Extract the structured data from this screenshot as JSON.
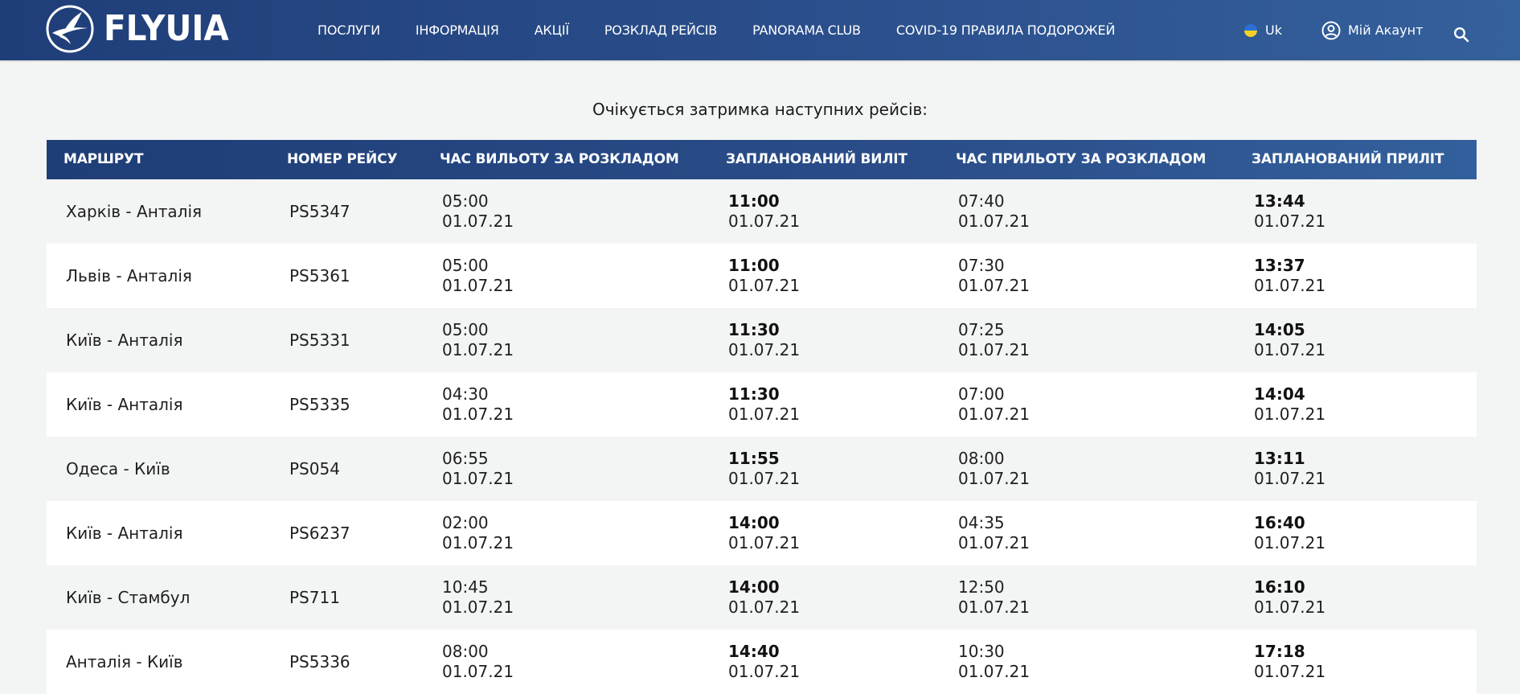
{
  "brand": {
    "name": "FLYUIA"
  },
  "nav": [
    {
      "label": "ПОСЛУГИ"
    },
    {
      "label": "ІНФОРМАЦІЯ"
    },
    {
      "label": "АКЦІЇ"
    },
    {
      "label": "РОЗКЛАД РЕЙСІВ"
    },
    {
      "label": "PANORAMA CLUB"
    },
    {
      "label": "COVID-19 ПРАВИЛА ПОДОРОЖЕЙ"
    }
  ],
  "language": {
    "label": "Uk",
    "flag_colors": [
      "#2d6fd6",
      "#f3d128"
    ]
  },
  "account": {
    "label": "Мій Акаунт"
  },
  "icons": {
    "search": "search-icon",
    "account": "user-circle-icon",
    "logo": "uia-logo-icon"
  },
  "headline": "Очікується затримка наступних рейсів:",
  "table": {
    "headers": {
      "route": "МАРШРУТ",
      "flight": "НОМЕР РЕЙСУ",
      "sched_dep": "ЧАС ВИЛЬОТУ ЗА РОЗКЛАДОМ",
      "planned_dep": "ЗАПЛАНОВАНИЙ ВИЛІТ",
      "sched_arr": "ЧАС ПРИЛЬОТУ ЗА РОЗКЛАДОМ",
      "planned_arr": "ЗАПЛАНОВАНИЙ ПРИЛІТ"
    },
    "rows": [
      {
        "route": "Харків - Анталія",
        "flight": "PS5347",
        "sched_dep_time": "05:00",
        "sched_dep_date": "01.07.21",
        "planned_dep_time": "11:00",
        "planned_dep_date": "01.07.21",
        "sched_arr_time": "07:40",
        "sched_arr_date": "01.07.21",
        "planned_arr_time": "13:44",
        "planned_arr_date": "01.07.21"
      },
      {
        "route": "Львів - Анталія",
        "flight": "PS5361",
        "sched_dep_time": "05:00",
        "sched_dep_date": "01.07.21",
        "planned_dep_time": "11:00",
        "planned_dep_date": "01.07.21",
        "sched_arr_time": "07:30",
        "sched_arr_date": "01.07.21",
        "planned_arr_time": "13:37",
        "planned_arr_date": "01.07.21"
      },
      {
        "route": "Київ - Анталія",
        "flight": "PS5331",
        "sched_dep_time": "05:00",
        "sched_dep_date": "01.07.21",
        "planned_dep_time": "11:30",
        "planned_dep_date": "01.07.21",
        "sched_arr_time": "07:25",
        "sched_arr_date": "01.07.21",
        "planned_arr_time": "14:05",
        "planned_arr_date": "01.07.21"
      },
      {
        "route": "Київ - Анталія",
        "flight": "PS5335",
        "sched_dep_time": "04:30",
        "sched_dep_date": "01.07.21",
        "planned_dep_time": "11:30",
        "planned_dep_date": "01.07.21",
        "sched_arr_time": "07:00",
        "sched_arr_date": "01.07.21",
        "planned_arr_time": "14:04",
        "planned_arr_date": "01.07.21"
      },
      {
        "route": "Одеса - Київ",
        "flight": "PS054",
        "sched_dep_time": "06:55",
        "sched_dep_date": "01.07.21",
        "planned_dep_time": "11:55",
        "planned_dep_date": "01.07.21",
        "sched_arr_time": "08:00",
        "sched_arr_date": "01.07.21",
        "planned_arr_time": "13:11",
        "planned_arr_date": "01.07.21"
      },
      {
        "route": "Київ - Анталія",
        "flight": "PS6237",
        "sched_dep_time": "02:00",
        "sched_dep_date": "01.07.21",
        "planned_dep_time": "14:00",
        "planned_dep_date": "01.07.21",
        "sched_arr_time": "04:35",
        "sched_arr_date": "01.07.21",
        "planned_arr_time": "16:40",
        "planned_arr_date": "01.07.21"
      },
      {
        "route": "Київ - Стамбул",
        "flight": "PS711",
        "sched_dep_time": "10:45",
        "sched_dep_date": "01.07.21",
        "planned_dep_time": "14:00",
        "planned_dep_date": "01.07.21",
        "sched_arr_time": "12:50",
        "sched_arr_date": "01.07.21",
        "planned_arr_time": "16:10",
        "planned_arr_date": "01.07.21"
      },
      {
        "route": "Анталія - Київ",
        "flight": "PS5336",
        "sched_dep_time": "08:00",
        "sched_dep_date": "01.07.21",
        "planned_dep_time": "14:40",
        "planned_dep_date": "01.07.21",
        "sched_arr_time": "10:30",
        "sched_arr_date": "01.07.21",
        "planned_arr_time": "17:18",
        "planned_arr_date": "01.07.21"
      }
    ]
  }
}
